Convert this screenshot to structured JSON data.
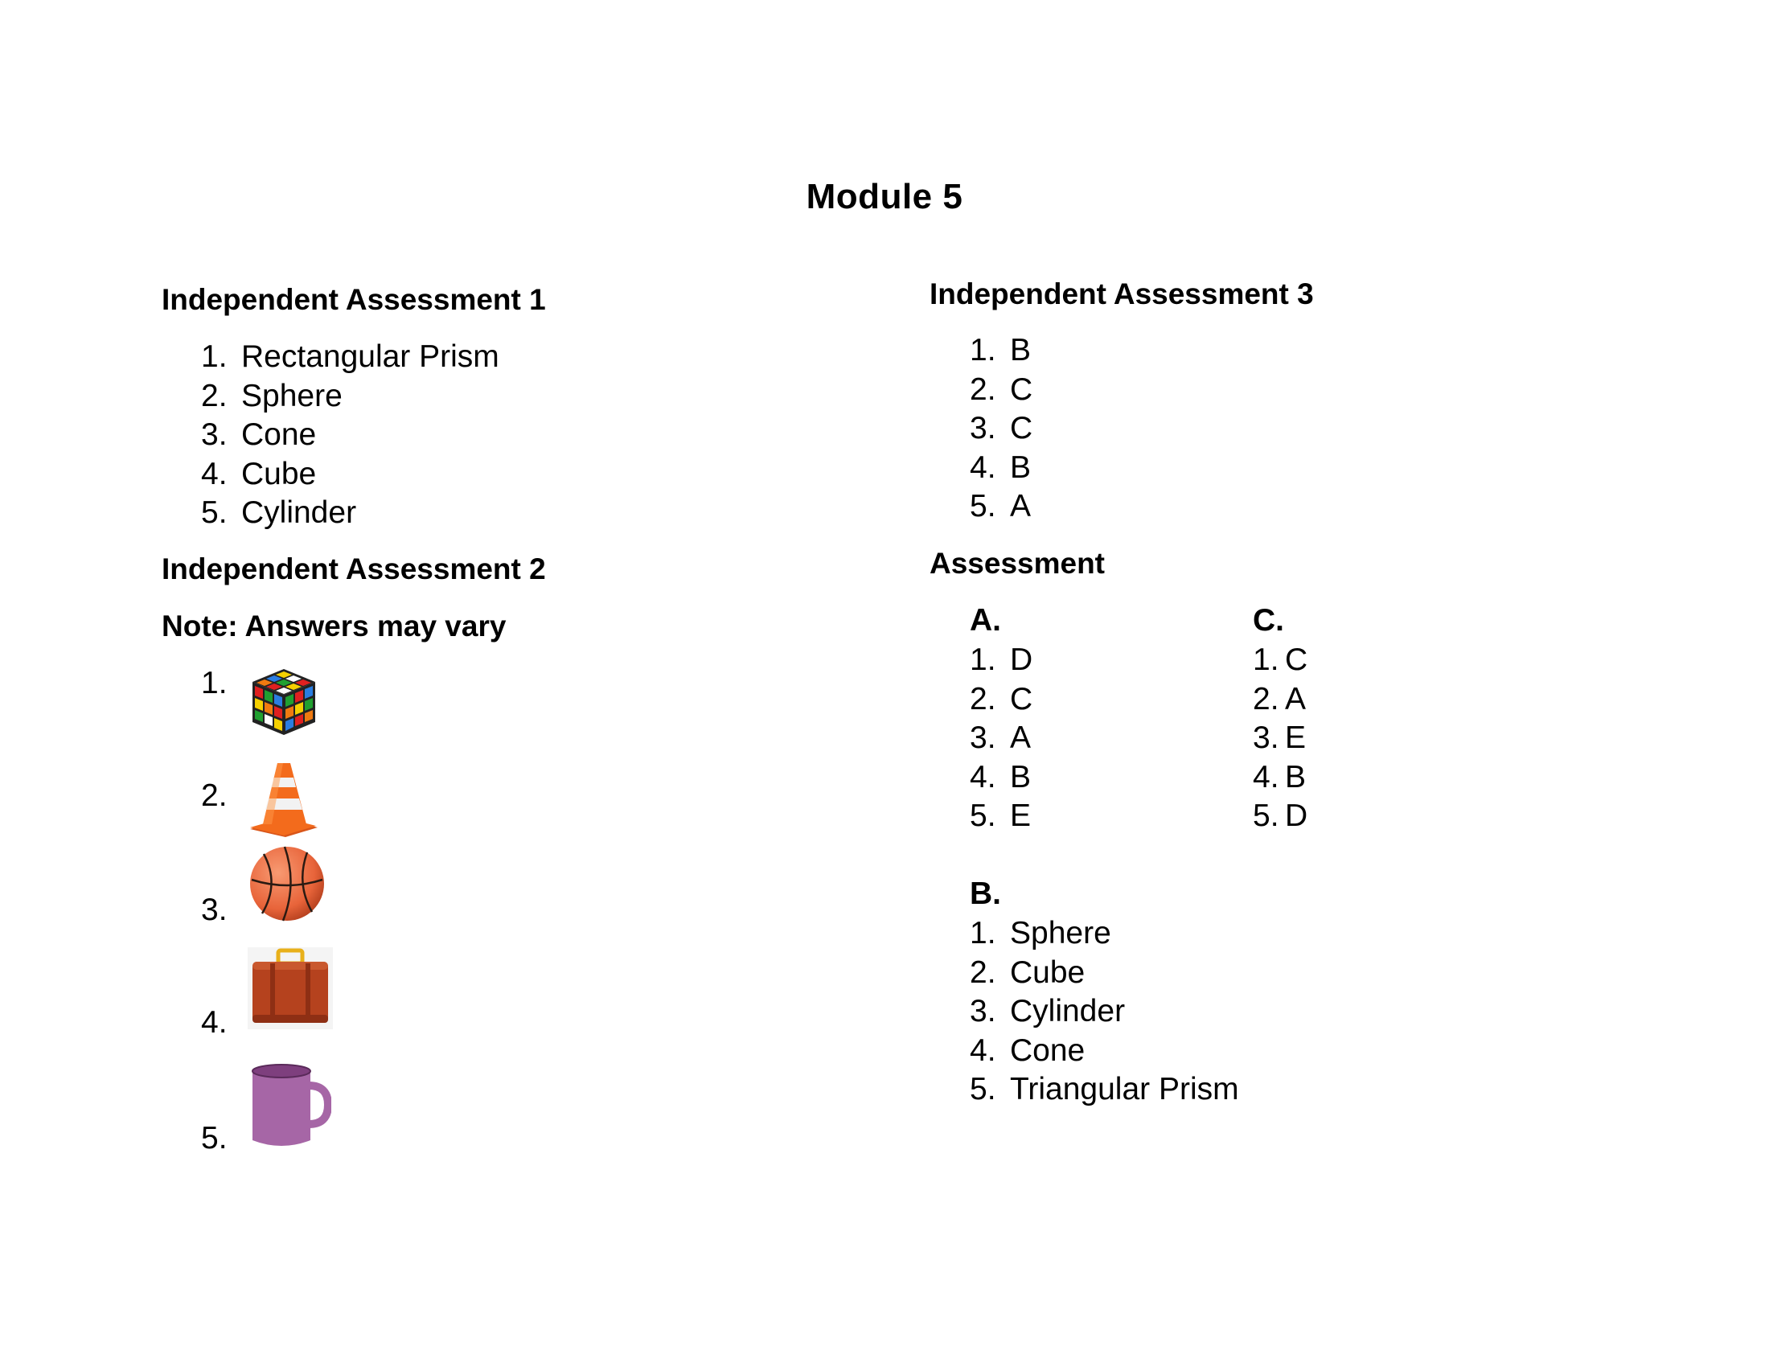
{
  "title": "Module 5",
  "left": {
    "ia1": {
      "heading": "Independent Assessment 1",
      "items": [
        {
          "num": "1.",
          "text": "Rectangular Prism"
        },
        {
          "num": "2.",
          "text": "Sphere"
        },
        {
          "num": "3.",
          "text": "Cone"
        },
        {
          "num": "4.",
          "text": "Cube"
        },
        {
          "num": "5.",
          "text": "Cylinder"
        }
      ]
    },
    "ia2": {
      "heading": "Independent Assessment 2",
      "note": "Note: Answers may vary",
      "items": [
        {
          "num": "1.",
          "icon": "rubiks-cube-icon"
        },
        {
          "num": "2.",
          "icon": "traffic-cone-icon"
        },
        {
          "num": "3.",
          "icon": "basketball-icon"
        },
        {
          "num": "4.",
          "icon": "suitcase-icon"
        },
        {
          "num": "5.",
          "icon": "mug-icon"
        }
      ]
    }
  },
  "right": {
    "ia3": {
      "heading": "Independent Assessment 3",
      "items": [
        {
          "num": "1.",
          "text": "B"
        },
        {
          "num": "2.",
          "text": "C"
        },
        {
          "num": "3.",
          "text": "C"
        },
        {
          "num": "4.",
          "text": "B"
        },
        {
          "num": "5.",
          "text": "A"
        }
      ]
    },
    "assessment": {
      "heading": "Assessment",
      "partA": {
        "label": "A.",
        "items": [
          {
            "num": "1.",
            "text": "D"
          },
          {
            "num": "2.",
            "text": "C"
          },
          {
            "num": "3.",
            "text": "A"
          },
          {
            "num": "4.",
            "text": "B"
          },
          {
            "num": "5.",
            "text": "E"
          }
        ]
      },
      "partC": {
        "label": "C.",
        "items": [
          {
            "num": "1.",
            "text": "C"
          },
          {
            "num": "2.",
            "text": "A"
          },
          {
            "num": "3.",
            "text": "E"
          },
          {
            "num": "4.",
            "text": "B"
          },
          {
            "num": "5.",
            "text": "D"
          }
        ]
      },
      "partB": {
        "label": "B.",
        "items": [
          {
            "num": "1.",
            "text": "Sphere"
          },
          {
            "num": "2.",
            "text": "Cube"
          },
          {
            "num": "3.",
            "text": "Cylinder"
          },
          {
            "num": "4.",
            "text": "Cone"
          },
          {
            "num": "5.",
            "text": "Triangular Prism"
          }
        ]
      }
    }
  },
  "colors": {
    "cone_orange": "#f36b1c",
    "ball_orange": "#e8643a",
    "suitcase_brown": "#b5421e",
    "mug_purple": "#a666a6"
  }
}
